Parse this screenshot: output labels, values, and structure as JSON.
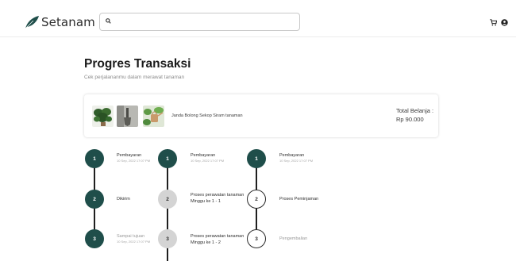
{
  "brand": {
    "name": "Setanam",
    "color": "#1f4e4a"
  },
  "search": {
    "placeholder": "",
    "value": ""
  },
  "nav": {
    "icons": [
      "cart-icon",
      "user-icon"
    ]
  },
  "page": {
    "title": "Progres Transaksi",
    "subtitle": "Cek perjalananmu dalam merawat tanaman"
  },
  "order": {
    "items_text": "Janda Bolong Sekop Siram tanaman",
    "total_label": "Total Belanja :",
    "total_value": "Rp 90.000",
    "thumbnails": [
      "plant-thumbnail",
      "shovel-thumbnail",
      "watering-can-thumbnail"
    ]
  },
  "tracks": [
    {
      "steps": [
        {
          "number": "1",
          "title": "Pembayaran",
          "date": "10 Sep, 2022 17:07 PM",
          "state": "done"
        },
        {
          "number": "2",
          "title": "Dikirim",
          "date": "",
          "state": "done"
        },
        {
          "number": "3",
          "title": "Sampai tujuan",
          "date": "10 Sep, 2022 17:07 PM",
          "state": "done"
        }
      ]
    },
    {
      "steps": [
        {
          "number": "1",
          "title": "Pembayaran",
          "date": "10 Sep, 2022 17:07 PM",
          "state": "done"
        },
        {
          "number": "2",
          "title": "Proses perawatan tanaman",
          "title2": "Minggu ke 1 - 1",
          "date": "",
          "state": "pending"
        },
        {
          "number": "3",
          "title": "Proses perawatan tanaman",
          "title2": "Minggu ke 1 - 2",
          "date": "",
          "state": "pending"
        }
      ]
    },
    {
      "steps": [
        {
          "number": "1",
          "title": "Pembayaran",
          "date": "10 Sep, 2022 17:07 PM",
          "state": "done"
        },
        {
          "number": "2",
          "title": "Proses Peminjaman",
          "date": "",
          "state": "todo"
        },
        {
          "number": "3",
          "title": "Pengembalian",
          "date": "",
          "state": "todo"
        }
      ]
    }
  ]
}
